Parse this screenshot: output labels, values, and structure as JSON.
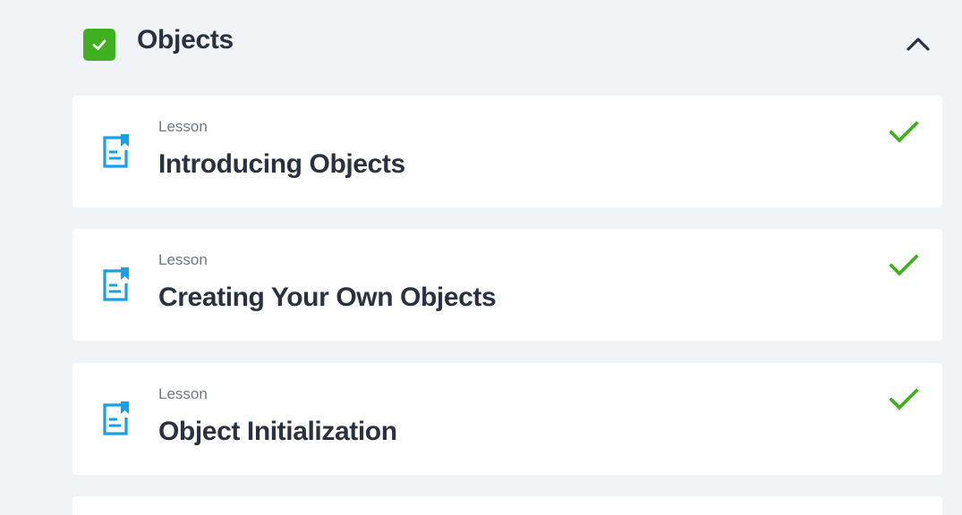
{
  "section": {
    "title": "Objects",
    "completed": true,
    "expanded": true,
    "colors": {
      "check_bg": "#3fb01f",
      "title": "#2a3140"
    }
  },
  "lessons": [
    {
      "type_label": "Lesson",
      "title": "Introducing Objects",
      "completed": true
    },
    {
      "type_label": "Lesson",
      "title": "Creating Your Own Objects",
      "completed": true
    },
    {
      "type_label": "Lesson",
      "title": "Object Initialization",
      "completed": true
    }
  ],
  "icons": {
    "section_status": "checkbox-checked-icon",
    "collapse": "chevron-up-icon",
    "lesson_type": "document-icon",
    "lesson_status": "checkmark-icon"
  },
  "colors": {
    "background": "#f1f4f7",
    "card": "#ffffff",
    "accent_blue": "#1a9ee6",
    "success_green": "#3fb01f",
    "muted_text": "#6d7685"
  }
}
